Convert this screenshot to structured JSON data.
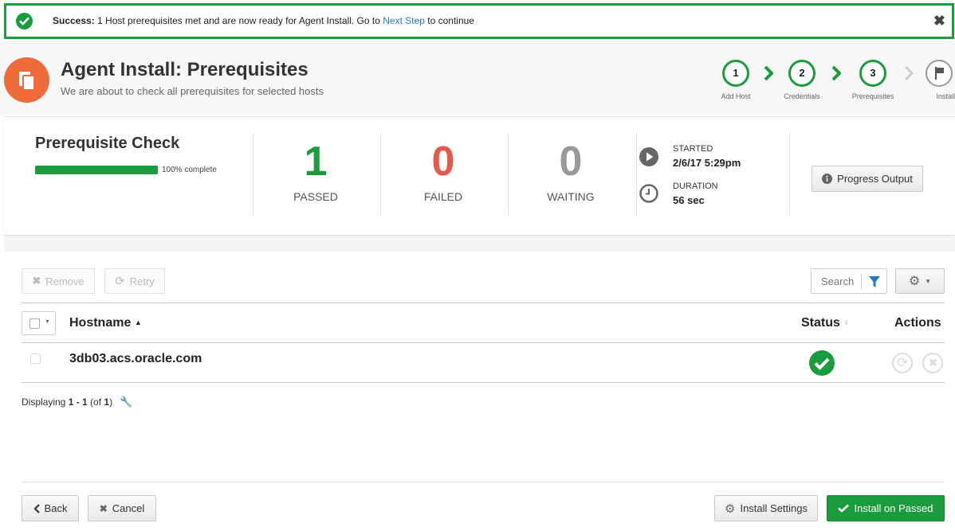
{
  "banner": {
    "bold": "Success:",
    "text": " 1 Host prerequisites met and are now ready for Agent Install. Go to ",
    "link": "Next Step",
    "tail": " to continue",
    "close": "✖"
  },
  "header": {
    "title": "Agent Install: Prerequisites",
    "subtitle": "We are about to check all prerequisites for selected hosts"
  },
  "steps": [
    {
      "num": "1",
      "label": "Add Host"
    },
    {
      "num": "2",
      "label": "Credentials"
    },
    {
      "num": "3",
      "label": "Prerequisites"
    },
    {
      "num": "",
      "label": "Install"
    }
  ],
  "summary": {
    "title": "Prerequisite Check",
    "progress_fraction": 1.0,
    "progress_label": "100% complete",
    "passed": {
      "value": "1",
      "label": "PASSED",
      "color": "#1a9c3c"
    },
    "failed": {
      "value": "0",
      "label": "FAILED",
      "color": "#e8574a"
    },
    "waiting": {
      "value": "0",
      "label": "WAITING",
      "color": "#999999"
    },
    "started_label": "STARTED",
    "started_value": "2/6/17 5:29pm",
    "duration_label": "DURATION",
    "duration_value": "56 sec",
    "progress_button": "Progress Output"
  },
  "toolbar": {
    "remove": "Remove",
    "retry": "Retry",
    "search_placeholder": "Search"
  },
  "table": {
    "columns": {
      "hostname": "Hostname",
      "status": "Status",
      "actions": "Actions"
    },
    "rows": [
      {
        "hostname": "3db03.acs.oracle.com",
        "status": "ok"
      }
    ]
  },
  "footer": {
    "prefix": "Displaying ",
    "range": "1 - 1",
    "mid": " (of ",
    "total": "1",
    "end": ")"
  },
  "actions": {
    "back": "Back",
    "cancel": "Cancel",
    "install_settings": "Install Settings",
    "install_on_passed": "Install on Passed"
  },
  "colors": {
    "success": "#1a9c3c",
    "brand_orange": "#f06b3a",
    "link": "#1f7ac7"
  }
}
